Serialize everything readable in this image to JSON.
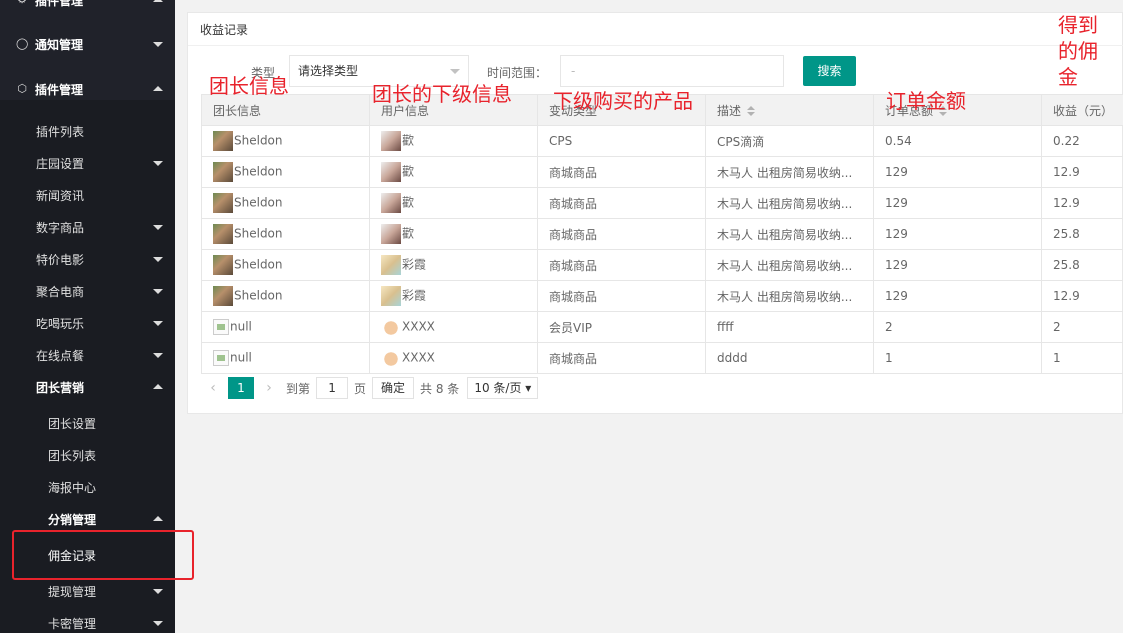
{
  "sidebar": {
    "items": [
      {
        "label": "插件管理",
        "expanded": true
      },
      {
        "label": "通知管理",
        "expanded": false
      },
      {
        "label": "插件管理",
        "expanded": true
      },
      {
        "label": "插件列表"
      },
      {
        "label": "庄园设置",
        "expanded": false
      },
      {
        "label": "新闻资讯"
      },
      {
        "label": "数字商品",
        "expanded": false
      },
      {
        "label": "特价电影",
        "expanded": false
      },
      {
        "label": "聚合电商",
        "expanded": false
      },
      {
        "label": "吃喝玩乐",
        "expanded": false
      },
      {
        "label": "在线点餐",
        "expanded": false
      },
      {
        "label": "团长营销",
        "expanded": true
      },
      {
        "label": "团长设置"
      },
      {
        "label": "团长列表"
      },
      {
        "label": "海报中心"
      },
      {
        "label": "分销管理",
        "expanded": true
      },
      {
        "label": "佣金记录",
        "selected": true
      },
      {
        "label": "提现管理",
        "expanded": false
      },
      {
        "label": "卡密管理",
        "expanded": false
      }
    ]
  },
  "panel": {
    "title": "收益记录",
    "filters": {
      "type_label": "类型",
      "type_value": "请选择类型",
      "range_label": "时间范围：",
      "range_value": "-",
      "search_label": "搜索"
    }
  },
  "table": {
    "columns": [
      "团长信息",
      "用户信息",
      "变动类型",
      "描述",
      "订单总额",
      "收益（元）"
    ],
    "rows": [
      {
        "leader": "Sheldon",
        "user": "歡",
        "type": "CPS",
        "desc": "CPS滴滴",
        "total": "0.54",
        "income": "0.22"
      },
      {
        "leader": "Sheldon",
        "user": "歡",
        "type": "商城商品",
        "desc": "木马人 出租房简易收纳...",
        "total": "129",
        "income": "12.9"
      },
      {
        "leader": "Sheldon",
        "user": "歡",
        "type": "商城商品",
        "desc": "木马人 出租房简易收纳...",
        "total": "129",
        "income": "12.9"
      },
      {
        "leader": "Sheldon",
        "user": "歡",
        "type": "商城商品",
        "desc": "木马人 出租房简易收纳...",
        "total": "129",
        "income": "25.8"
      },
      {
        "leader": "Sheldon",
        "user": "彩霞",
        "type": "商城商品",
        "desc": "木马人 出租房简易收纳...",
        "total": "129",
        "income": "25.8"
      },
      {
        "leader": "Sheldon",
        "user": "彩霞",
        "type": "商城商品",
        "desc": "木马人 出租房简易收纳...",
        "total": "129",
        "income": "12.9"
      },
      {
        "leader": "null",
        "user": "XXXX",
        "type": "会员VIP",
        "desc": "ffff",
        "total": "2",
        "income": "2"
      },
      {
        "leader": "null",
        "user": "XXXX",
        "type": "商城商品",
        "desc": "dddd",
        "total": "1",
        "income": "1"
      }
    ]
  },
  "pagination": {
    "current": "1",
    "goto_label": "到第",
    "goto_value": "1",
    "page_unit": "页",
    "confirm_label": "确定",
    "total_text": "共 8 条",
    "page_size": "10 条/页"
  },
  "annotations": {
    "leader_info": "团长信息",
    "subordinate_info": "团长的下级信息",
    "product": "下级购买的产品",
    "order_amount": "订单金额",
    "commission": "得到的佣金"
  },
  "colors": {
    "sidebar_bg": "#20222a",
    "accent": "#009688",
    "annotation_red": "#e8232c"
  }
}
